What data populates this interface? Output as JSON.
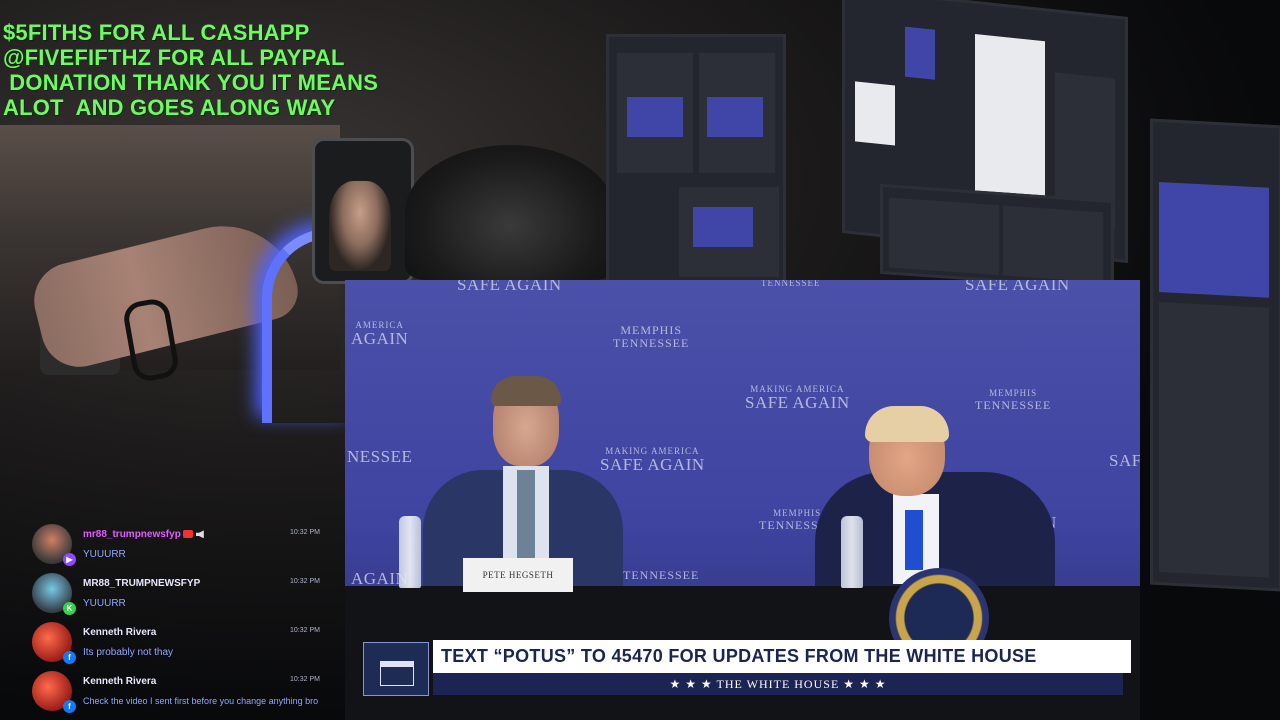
{
  "donation_lines": [
    "$5FITHS FOR ALL CASHAPP",
    "@FIVEFIFTHZ FOR ALL PAYPAL",
    " DONATION THANK YOU IT MEANS",
    "ALOT  AND GOES ALONG WAY"
  ],
  "backdrop": {
    "safe_again_top_left": "SAFE AGAIN",
    "tennessee_top": "TENNESSEE",
    "safe_again_top_right": "SAFE AGAIN",
    "america_again": "AGAIN",
    "america_small": "AMERICA",
    "memphis_tennessee": "MEMPHIS\nTENNESSEE",
    "making_america": "MAKING AMERICA",
    "safe_again": "SAFE AGAIN",
    "memphis": "MEMPHIS",
    "tennessee": "TENNESSEE",
    "nessee": "NESSEE",
    "safe_cut": "SAF",
    "ain": "AIN",
    "again_left_bottom": "AGAIN"
  },
  "nameplate": "PETE HEGSETH",
  "chyron": {
    "main": "TEXT “POTUS” TO 45470 FOR UPDATES FROM THE WHITE HOUSE",
    "sub": "★ ★ ★   THE WHITE HOUSE   ★ ★ ★"
  },
  "chat": [
    {
      "user": "mr88_trumpnewsfyp",
      "time": "10:32 PM",
      "text": "YUUURR",
      "platform": "twitch",
      "color": "#e05cff"
    },
    {
      "user": "MR88_TRUMPNEWSFYP",
      "time": "10:32 PM",
      "text": "YUUURR",
      "platform": "kick",
      "color": "#e7e7ff"
    },
    {
      "user": "Kenneth Rivera",
      "time": "10:32 PM",
      "text": "Its probably not thay",
      "platform": "facebook",
      "color": "#e7e7ff"
    },
    {
      "user": "Kenneth Rivera",
      "time": "10:32 PM",
      "text": "Check the video I sent first before you change anything bro",
      "platform": "facebook",
      "color": "#e7e7ff"
    }
  ],
  "colors": {
    "donation_text": "#6dfc5f",
    "video_backdrop": "#4b50a8",
    "chyron_navy": "#1b2452",
    "chat_message": "#8fa8ff"
  }
}
